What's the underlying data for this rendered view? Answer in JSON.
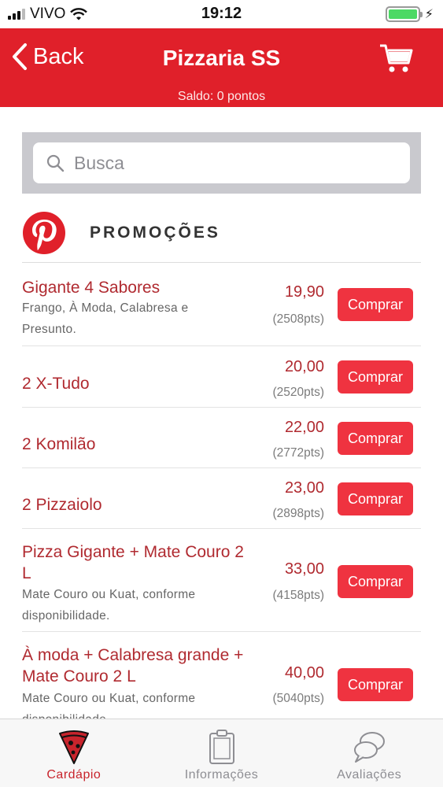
{
  "status_bar": {
    "carrier": "VIVO",
    "time": "19:12"
  },
  "header": {
    "back_label": "Back",
    "title": "Pizzaria SS",
    "saldo": "Saldo: 0 pontos"
  },
  "search": {
    "placeholder": "Busca",
    "value": ""
  },
  "section": {
    "title": "PROMOÇÕES"
  },
  "items": [
    {
      "name": "Gigante 4 Sabores",
      "desc": "Frango, À Moda, Calabresa e Presunto.",
      "price": "19,90",
      "pts": "(2508pts)",
      "buy": "Comprar"
    },
    {
      "name": "2 X-Tudo",
      "desc": "",
      "price": "20,00",
      "pts": "(2520pts)",
      "buy": "Comprar"
    },
    {
      "name": "2 Komilão",
      "desc": "",
      "price": "22,00",
      "pts": "(2772pts)",
      "buy": "Comprar"
    },
    {
      "name": "2 Pizzaiolo",
      "desc": "",
      "price": "23,00",
      "pts": "(2898pts)",
      "buy": "Comprar"
    },
    {
      "name": "Pizza Gigante + Mate Couro 2 L",
      "desc": "Mate Couro ou Kuat, conforme disponibilidade.",
      "price": "33,00",
      "pts": "(4158pts)",
      "buy": "Comprar"
    },
    {
      "name": "À moda + Calabresa grande + Mate Couro 2 L",
      "desc": "Mate Couro ou Kuat, conforme disponibilidade.",
      "price": "40,00",
      "pts": "(5040pts)",
      "buy": "Comprar"
    }
  ],
  "tabs": [
    {
      "label": "Cardápio",
      "icon": "pizza-slice-icon",
      "active": true
    },
    {
      "label": "Informações",
      "icon": "clipboard-icon",
      "active": false
    },
    {
      "label": "Avaliações",
      "icon": "speech-bubbles-icon",
      "active": false
    }
  ],
  "colors": {
    "accent": "#e0202a",
    "button": "#ef3340",
    "item_text": "#b02a30",
    "battery": "#4cd964"
  }
}
